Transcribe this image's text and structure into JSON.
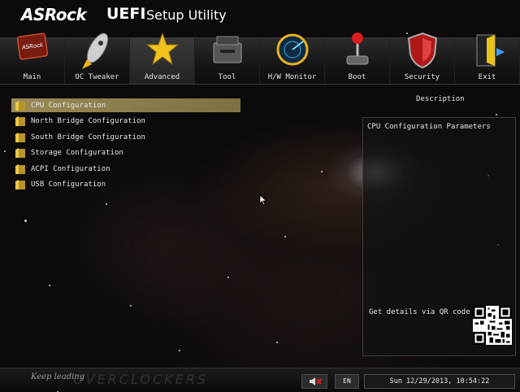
{
  "header": {
    "brand": "ASRock",
    "uefi": "UEFI",
    "subtitle": "Setup Utility"
  },
  "nav": {
    "tabs": [
      {
        "label": "Main",
        "icon": "main-icon"
      },
      {
        "label": "OC Tweaker",
        "icon": "rocket-icon"
      },
      {
        "label": "Advanced",
        "icon": "star-icon",
        "active": true
      },
      {
        "label": "Tool",
        "icon": "toolbox-icon"
      },
      {
        "label": "H/W Monitor",
        "icon": "radar-icon"
      },
      {
        "label": "Boot",
        "icon": "joystick-icon"
      },
      {
        "label": "Security",
        "icon": "shield-icon"
      },
      {
        "label": "Exit",
        "icon": "exit-door-icon"
      }
    ]
  },
  "menu": {
    "items": [
      {
        "label": "CPU Configuration",
        "selected": true
      },
      {
        "label": "North Bridge Configuration"
      },
      {
        "label": "South Bridge Configuration"
      },
      {
        "label": "Storage Configuration"
      },
      {
        "label": "ACPI Configuration"
      },
      {
        "label": "USB Configuration"
      }
    ]
  },
  "description": {
    "title": "Description",
    "text": "CPU Configuration Parameters",
    "qr_text": "Get details via QR code"
  },
  "footer": {
    "tagline": "Keep leading",
    "watermark": "OVERCLOCKERS",
    "language": "EN",
    "datetime": "Sun 12/29/2013, 10:54:22"
  },
  "colors": {
    "selection": "#9a8a55",
    "folder": "#c9a52a",
    "background": "#0c0a0a"
  }
}
